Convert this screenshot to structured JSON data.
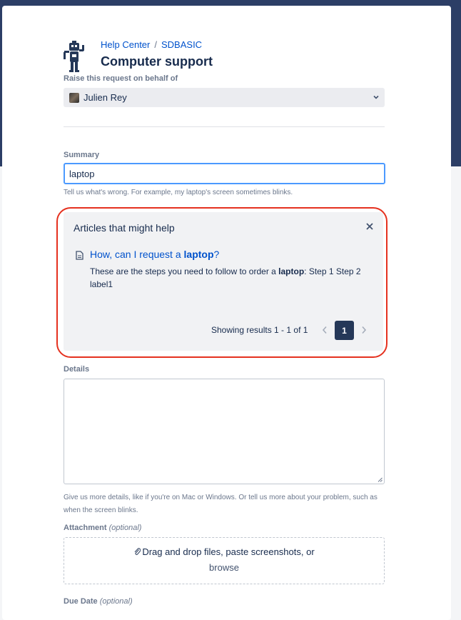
{
  "breadcrumb": {
    "root": "Help Center",
    "separator": "/",
    "project": "SDBASIC"
  },
  "page_title": "Computer support",
  "on_behalf": {
    "label": "Raise this request on behalf of",
    "selected_user": "Julien Rey"
  },
  "summary": {
    "label": "Summary",
    "value": "laptop",
    "help": "Tell us what's wrong. For example, my laptop's screen sometimes blinks."
  },
  "articles": {
    "title": "Articles that might help",
    "items": [
      {
        "title_prefix": "How, can I request a ",
        "title_highlight": "laptop",
        "title_suffix": "?",
        "snippet_prefix": "These are the steps you need to follow to order a ",
        "snippet_highlight": "laptop",
        "snippet_suffix": ": Step 1 Step 2 label1"
      }
    ],
    "results_text": "Showing results 1 - 1 of 1",
    "current_page": "1"
  },
  "details": {
    "label": "Details",
    "help": "Give us more details, like if you're on Mac or Windows. Or tell us more about your problem, such as when the screen blinks."
  },
  "attachment": {
    "label": "Attachment",
    "optional": "(optional)",
    "drop_text": "Drag and drop files, paste screenshots, or",
    "browse": "browse"
  },
  "due_date": {
    "label": "Due Date",
    "optional": "(optional)"
  },
  "colors": {
    "header_band": "#2c3e66",
    "link": "#0052cc",
    "focus": "#4c9aff",
    "highlight": "#e5311f",
    "page_button": "#253858"
  }
}
